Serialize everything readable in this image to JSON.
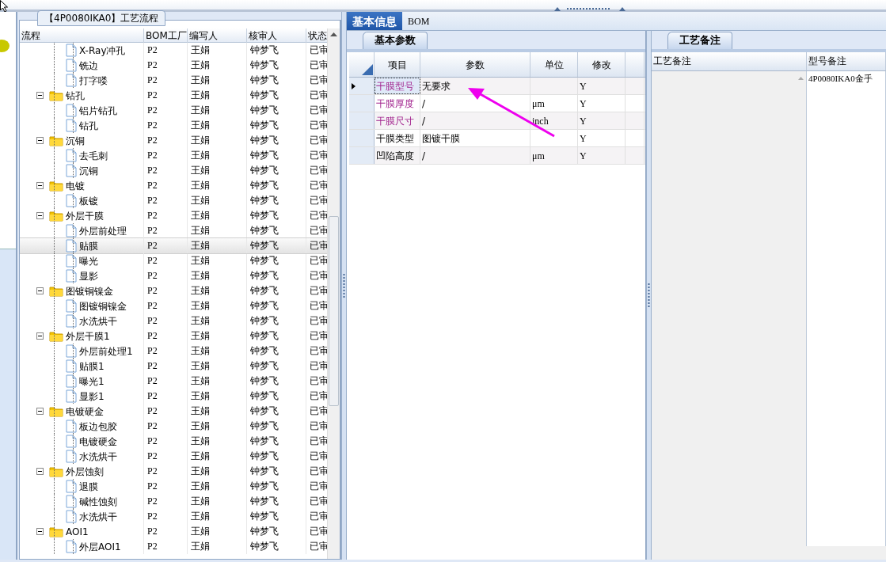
{
  "left_panel": {
    "group_title": "【4P0080IKA0】工艺流程",
    "columns": [
      "流程",
      "BOM工厂",
      "编写人",
      "核审人",
      "状态"
    ],
    "tree": [
      {
        "kind": "step",
        "label": "X-Ray冲孔",
        "selected": false,
        "bom": "P2",
        "writer": "王娟",
        "reviewer": "钟梦飞",
        "status": "已审"
      },
      {
        "kind": "step",
        "label": "铣边",
        "selected": false,
        "bom": "P2",
        "writer": "王娟",
        "reviewer": "钟梦飞",
        "status": "已审"
      },
      {
        "kind": "step",
        "label": "打字喽",
        "selected": false,
        "bom": "P2",
        "writer": "王娟",
        "reviewer": "钟梦飞",
        "status": "已审"
      },
      {
        "kind": "group",
        "label": "钻孔",
        "expanded": true,
        "selected": false,
        "bom": "P2",
        "writer": "王娟",
        "reviewer": "钟梦飞",
        "status": "已审",
        "children": [
          {
            "kind": "step",
            "label": "铝片钻孔",
            "selected": false,
            "bom": "P2",
            "writer": "王娟",
            "reviewer": "钟梦飞",
            "status": "已审"
          },
          {
            "kind": "step",
            "label": "钻孔",
            "selected": false,
            "bom": "P2",
            "writer": "王娟",
            "reviewer": "钟梦飞",
            "status": "已审"
          }
        ]
      },
      {
        "kind": "group",
        "label": "沉铜",
        "expanded": true,
        "selected": false,
        "bom": "P2",
        "writer": "王娟",
        "reviewer": "钟梦飞",
        "status": "已审",
        "children": [
          {
            "kind": "step",
            "label": "去毛刺",
            "selected": false,
            "bom": "P2",
            "writer": "王娟",
            "reviewer": "钟梦飞",
            "status": "已审"
          },
          {
            "kind": "step",
            "label": "沉铜",
            "selected": false,
            "bom": "P2",
            "writer": "王娟",
            "reviewer": "钟梦飞",
            "status": "已审"
          }
        ]
      },
      {
        "kind": "group",
        "label": "电镀",
        "expanded": true,
        "selected": false,
        "bom": "P2",
        "writer": "王娟",
        "reviewer": "钟梦飞",
        "status": "已审",
        "children": [
          {
            "kind": "step",
            "label": "板镀",
            "selected": false,
            "bom": "P2",
            "writer": "王娟",
            "reviewer": "钟梦飞",
            "status": "已审"
          }
        ]
      },
      {
        "kind": "group",
        "label": "外层干膜",
        "expanded": true,
        "selected": false,
        "bom": "P2",
        "writer": "王娟",
        "reviewer": "钟梦飞",
        "status": "已审",
        "children": [
          {
            "kind": "step",
            "label": "外层前处理",
            "selected": false,
            "bom": "P2",
            "writer": "王娟",
            "reviewer": "钟梦飞",
            "status": "已审"
          },
          {
            "kind": "step",
            "label": "贴膜",
            "selected": true,
            "bom": "P2",
            "writer": "王娟",
            "reviewer": "钟梦飞",
            "status": "已审"
          },
          {
            "kind": "step",
            "label": "曝光",
            "selected": false,
            "bom": "P2",
            "writer": "王娟",
            "reviewer": "钟梦飞",
            "status": "已审"
          },
          {
            "kind": "step",
            "label": "显影",
            "selected": false,
            "bom": "P2",
            "writer": "王娟",
            "reviewer": "钟梦飞",
            "status": "已审"
          }
        ]
      },
      {
        "kind": "group",
        "label": "图镀铜镍金",
        "expanded": true,
        "selected": false,
        "bom": "P2",
        "writer": "王娟",
        "reviewer": "钟梦飞",
        "status": "已审",
        "children": [
          {
            "kind": "step",
            "label": "图镀铜镍金",
            "selected": false,
            "bom": "P2",
            "writer": "王娟",
            "reviewer": "钟梦飞",
            "status": "已审"
          },
          {
            "kind": "step",
            "label": "水洗烘干",
            "selected": false,
            "bom": "P2",
            "writer": "王娟",
            "reviewer": "钟梦飞",
            "status": "已审"
          }
        ]
      },
      {
        "kind": "group",
        "label": "外层干膜1",
        "expanded": true,
        "selected": false,
        "bom": "P2",
        "writer": "王娟",
        "reviewer": "钟梦飞",
        "status": "已审",
        "children": [
          {
            "kind": "step",
            "label": "外层前处理1",
            "selected": false,
            "bom": "P2",
            "writer": "王娟",
            "reviewer": "钟梦飞",
            "status": "已审"
          },
          {
            "kind": "step",
            "label": "贴膜1",
            "selected": false,
            "bom": "P2",
            "writer": "王娟",
            "reviewer": "钟梦飞",
            "status": "已审"
          },
          {
            "kind": "step",
            "label": "曝光1",
            "selected": false,
            "bom": "P2",
            "writer": "王娟",
            "reviewer": "钟梦飞",
            "status": "已审"
          },
          {
            "kind": "step",
            "label": "显影1",
            "selected": false,
            "bom": "P2",
            "writer": "王娟",
            "reviewer": "钟梦飞",
            "status": "已审"
          }
        ]
      },
      {
        "kind": "group",
        "label": "电镀硬金",
        "expanded": true,
        "selected": false,
        "bom": "P2",
        "writer": "王娟",
        "reviewer": "钟梦飞",
        "status": "已审",
        "children": [
          {
            "kind": "step",
            "label": "板边包胶",
            "selected": false,
            "bom": "P2",
            "writer": "王娟",
            "reviewer": "钟梦飞",
            "status": "已审"
          },
          {
            "kind": "step",
            "label": "电镀硬金",
            "selected": false,
            "bom": "P2",
            "writer": "王娟",
            "reviewer": "钟梦飞",
            "status": "已审"
          },
          {
            "kind": "step",
            "label": "水洗烘干",
            "selected": false,
            "bom": "P2",
            "writer": "王娟",
            "reviewer": "钟梦飞",
            "status": "已审"
          }
        ]
      },
      {
        "kind": "group",
        "label": "外层蚀刻",
        "expanded": true,
        "selected": false,
        "bom": "P2",
        "writer": "王娟",
        "reviewer": "钟梦飞",
        "status": "已审",
        "children": [
          {
            "kind": "step",
            "label": "退膜",
            "selected": false,
            "bom": "P2",
            "writer": "王娟",
            "reviewer": "钟梦飞",
            "status": "已审"
          },
          {
            "kind": "step",
            "label": "碱性蚀刻",
            "selected": false,
            "bom": "P2",
            "writer": "王娟",
            "reviewer": "钟梦飞",
            "status": "已审"
          },
          {
            "kind": "step",
            "label": "水洗烘干",
            "selected": false,
            "bom": "P2",
            "writer": "王娟",
            "reviewer": "钟梦飞",
            "status": "已审"
          }
        ]
      },
      {
        "kind": "group",
        "label": "AOI1",
        "expanded": true,
        "selected": false,
        "bom": "P2",
        "writer": "王娟",
        "reviewer": "钟梦飞",
        "status": "已审",
        "children": [
          {
            "kind": "step",
            "label": "外层AOI1",
            "selected": false,
            "bom": "P2",
            "writer": "王娟",
            "reviewer": "钟梦飞",
            "status": "已审"
          }
        ]
      }
    ]
  },
  "tabs": [
    {
      "label": "基本信息",
      "selected": true
    },
    {
      "label": "BOM",
      "selected": false
    }
  ],
  "params_panel": {
    "tab": "基本参数",
    "columns": [
      "项目",
      "参数",
      "单位",
      "修改"
    ],
    "rows": [
      {
        "item": "干膜型号",
        "value": "无要求",
        "unit": "",
        "modify": "Y",
        "kind": "required",
        "selected": true
      },
      {
        "item": "干膜厚度",
        "value": "/",
        "unit": "μm",
        "modify": "Y",
        "kind": "required",
        "selected": false
      },
      {
        "item": "干膜尺寸",
        "value": "/",
        "unit": "inch",
        "modify": "Y",
        "kind": "required",
        "selected": false
      },
      {
        "item": "干膜类型",
        "value": "图镀干膜",
        "unit": "",
        "modify": "Y",
        "kind": "normal",
        "selected": false
      },
      {
        "item": "凹陷高度",
        "value": "/",
        "unit": "μm",
        "modify": "Y",
        "kind": "normal",
        "selected": false
      }
    ]
  },
  "notes_panel": {
    "tab": "工艺备注",
    "columns": [
      "工艺备注",
      "型号备注"
    ],
    "model_note": "4P0080IKA0金手"
  }
}
